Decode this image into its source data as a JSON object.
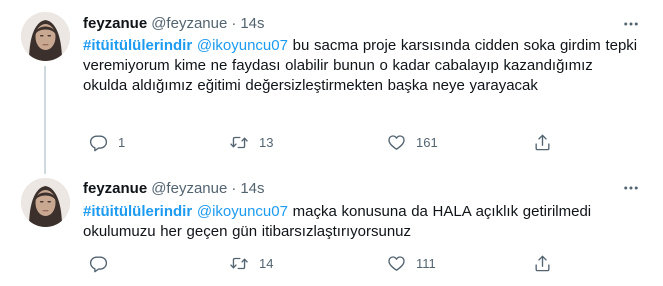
{
  "tweets": [
    {
      "name": "feyzanue",
      "handle": "@feyzanue",
      "separator": "·",
      "time": "14s",
      "text": {
        "hashtag": "#itüitülülerindir",
        "mention": "@ikoyuncu07",
        "body": " bu sacma proje karsısında cidden soka girdim tepki veremiyorum kime ne faydası olabilir bunun o kadar cabalayıp kazandığımız okulda aldığımız eğitimi değersizleştirmekten başka neye yarayacak"
      },
      "replies": "1",
      "retweets": "13",
      "likes": "161"
    },
    {
      "name": "feyzanue",
      "handle": "@feyzanue",
      "separator": "·",
      "time": "14s",
      "text": {
        "hashtag": "#itüitülülerindir",
        "mention": "@ikoyuncu07",
        "body": " maçka konusuna da HALA açıklık getirilmedi okulumuzu her geçen gün itibarsızlaştırıyorsunuz"
      },
      "replies": "",
      "retweets": "14",
      "likes": "111"
    }
  ],
  "icons": {
    "reply": "reply-icon",
    "retweet": "retweet-icon",
    "like": "like-icon",
    "share": "share-icon",
    "more": "more-icon"
  },
  "colors": {
    "link": "#1d9bf0",
    "secondary_text": "#536471",
    "primary_text": "#0f1419",
    "thread_line": "#cfd9de"
  }
}
